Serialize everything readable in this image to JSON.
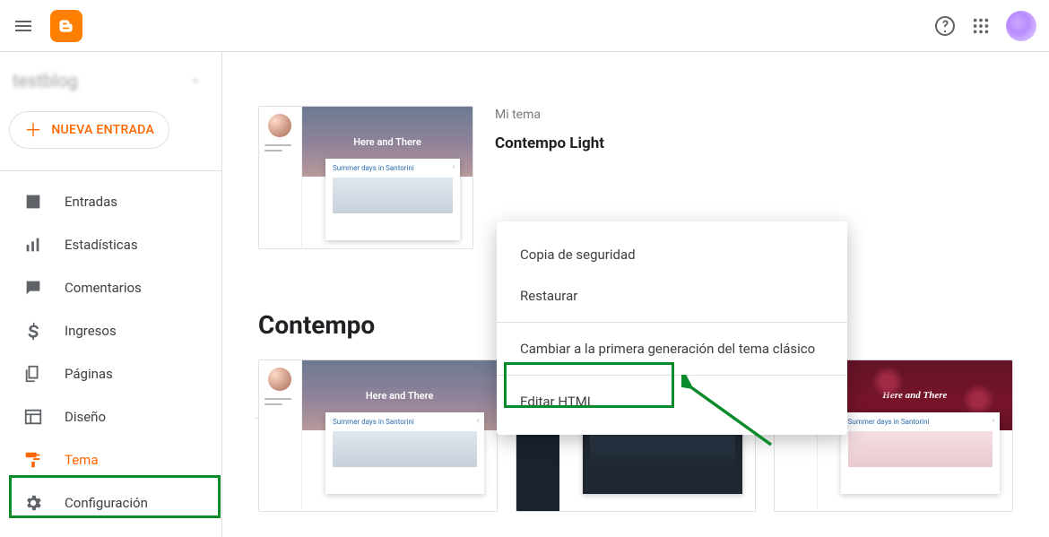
{
  "header": {
    "blog_name": "testblog"
  },
  "sidebar": {
    "new_entry_label": "NUEVA ENTRADA",
    "items": [
      {
        "label": "Entradas",
        "icon": "post"
      },
      {
        "label": "Estadísticas",
        "icon": "stats"
      },
      {
        "label": "Comentarios",
        "icon": "comment"
      },
      {
        "label": "Ingresos",
        "icon": "dollar"
      },
      {
        "label": "Páginas",
        "icon": "pages"
      },
      {
        "label": "Diseño",
        "icon": "layout"
      },
      {
        "label": "Tema",
        "icon": "roller",
        "active": true
      },
      {
        "label": "Configuración",
        "icon": "gear"
      }
    ]
  },
  "theme": {
    "section_label": "Mi tema",
    "current_name": "Contempo Light",
    "preview_title": "Here and There",
    "preview_post": "Summer days in Santorini",
    "gallery_title": "Contempo"
  },
  "menu": {
    "items": [
      "Copia de seguridad",
      "Restaurar",
      "Cambiar a la primera generación del tema clásico",
      "Editar HTML"
    ]
  }
}
